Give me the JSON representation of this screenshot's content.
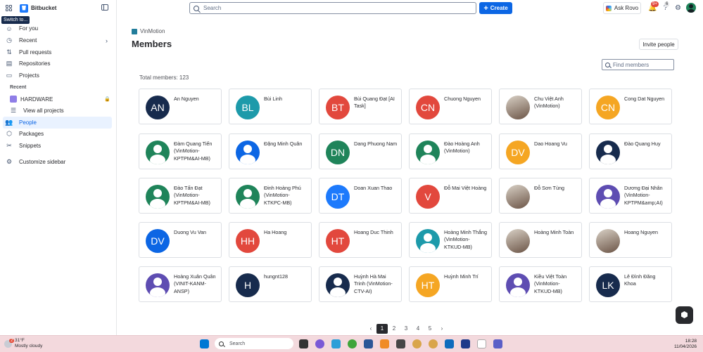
{
  "app": {
    "name": "Bitbucket",
    "tooltip": "Switch to..."
  },
  "sidebar": {
    "items": [
      {
        "label": "For you"
      },
      {
        "label": "Recent"
      },
      {
        "label": "Pull requests"
      },
      {
        "label": "Repositories"
      },
      {
        "label": "Projects"
      }
    ],
    "recent_heading": "Recent",
    "recent_project": "HARDWARE",
    "view_all": "View all projects",
    "bottom_items": [
      {
        "label": "People"
      },
      {
        "label": "Packages"
      },
      {
        "label": "Snippets"
      },
      {
        "label": "Customize sidebar"
      }
    ]
  },
  "topbar": {
    "search_placeholder": "Search",
    "create_label": "Create",
    "rovo_label": "Ask Rovo",
    "notifications_badge": "9+",
    "help_badge": "6"
  },
  "main": {
    "breadcrumb": "VinMotion",
    "title": "Members",
    "invite_label": "Invite people",
    "total_label": "Total members: 123",
    "find_placeholder": "Find members"
  },
  "members": [
    {
      "name": "An Nguyen",
      "initials": "AN",
      "color": "#172b4d"
    },
    {
      "name": "Bùi Linh",
      "initials": "BL",
      "color": "#1d9aaa"
    },
    {
      "name": "Bùi Quang Đạt [AI Task]",
      "initials": "BT",
      "color": "#e2483d"
    },
    {
      "name": "Chuong Nguyen",
      "initials": "CN",
      "color": "#e2483d"
    },
    {
      "name": "Chu Việt Anh (VinMotion)",
      "initials": "",
      "color": "photo"
    },
    {
      "name": "Cong Dat Nguyen",
      "initials": "CN",
      "color": "#f5a623"
    },
    {
      "name": "Đàm Quang Tiến (VinMotion-KPTPM&AI-MB)",
      "initials": "",
      "color": "#1f845a"
    },
    {
      "name": "Đặng Minh Quân",
      "initials": "",
      "color": "#0c66e4"
    },
    {
      "name": "Dang Phuong Nam",
      "initials": "DN",
      "color": "#1f845a"
    },
    {
      "name": "Đào Hoàng Anh (VinMotion)",
      "initials": "",
      "color": "#1f845a"
    },
    {
      "name": "Dao Hoang Vu",
      "initials": "DV",
      "color": "#f5a623"
    },
    {
      "name": "Đào Quang Huy",
      "initials": "",
      "color": "#172b4d"
    },
    {
      "name": "Đào Tấn Đạt (VinMotion-KPTPM&AI-MB)",
      "initials": "",
      "color": "#1f845a"
    },
    {
      "name": "Đinh Hoàng Phú (VinMotion-KTKPC-MB)",
      "initials": "",
      "color": "#1f845a"
    },
    {
      "name": "Doan Xuan Thao",
      "initials": "DT",
      "color": "#1d7afc"
    },
    {
      "name": "Đỗ Mai Việt Hoàng",
      "initials": "V",
      "color": "#e2483d"
    },
    {
      "name": "Đỗ Sơn Tùng",
      "initials": "",
      "color": "photo"
    },
    {
      "name": "Dương Đại Nhân (VinMotion-KPTPM&amp;AI)",
      "initials": "",
      "color": "#5e4db2"
    },
    {
      "name": "Duong Vu Van",
      "initials": "DV",
      "color": "#0c66e4"
    },
    {
      "name": "Ha Hoang",
      "initials": "HH",
      "color": "#e2483d"
    },
    {
      "name": "Hoang Duc Thinh",
      "initials": "HT",
      "color": "#e2483d"
    },
    {
      "name": "Hoàng Minh Thắng (VinMotion-KTKUD-MB)",
      "initials": "",
      "color": "#1d9aaa"
    },
    {
      "name": "Hoàng Minh Toàn",
      "initials": "",
      "color": "photo"
    },
    {
      "name": "Hoang Nguyen",
      "initials": "",
      "color": "photo"
    },
    {
      "name": "Hoàng Xuân Quân (VINIT-KANM-ANSP)",
      "initials": "",
      "color": "#5e4db2"
    },
    {
      "name": "hungnt128",
      "initials": "H",
      "color": "#172b4d"
    },
    {
      "name": "Huỳnh Hà Mai Trinh (VinMotion-CTV-AI)",
      "initials": "",
      "color": "#172b4d"
    },
    {
      "name": "Huỳnh Minh Trí",
      "initials": "HT",
      "color": "#f5a623"
    },
    {
      "name": "Kiều Việt Toàn (VinMotion-KTKUD-MB)",
      "initials": "",
      "color": "#5e4db2"
    },
    {
      "name": "Lê Đình Đăng Khoa",
      "initials": "LK",
      "color": "#172b4d"
    }
  ],
  "pagination": {
    "pages": [
      "1",
      "2",
      "3",
      "4",
      "5"
    ],
    "current": "1",
    "prev": "‹",
    "next": "›"
  },
  "taskbar": {
    "weather_badge": "2",
    "temperature": "31°F",
    "weather": "Mostly cloudy",
    "search_placeholder": "Search",
    "time": "18:28",
    "date": "11/04/2026"
  }
}
